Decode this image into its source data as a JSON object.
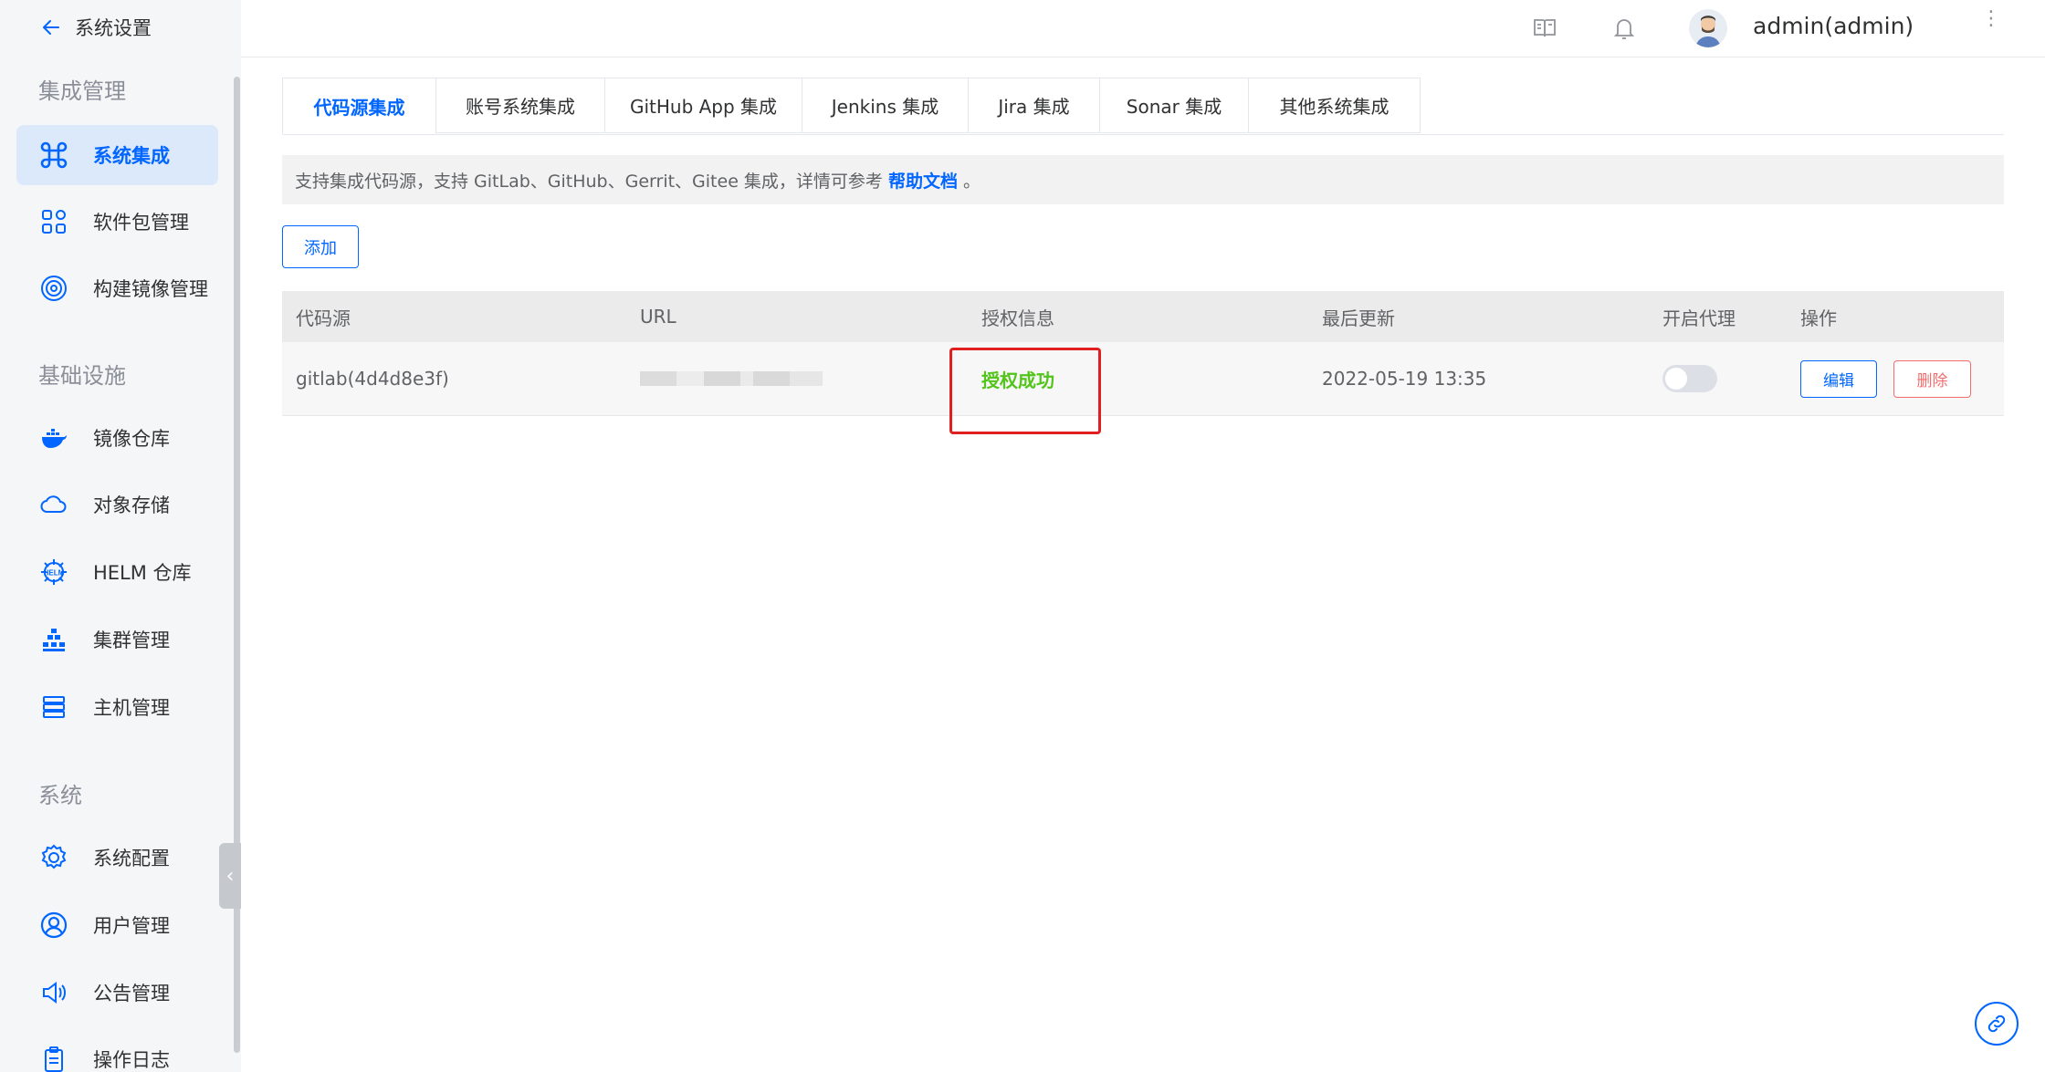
{
  "sidebar": {
    "back_label": "系统设置",
    "sections": [
      {
        "title": "集成管理"
      },
      {
        "title": "基础设施"
      },
      {
        "title": "系统"
      }
    ],
    "items": [
      {
        "label": "系统集成",
        "icon": "command-icon",
        "active": true
      },
      {
        "label": "软件包管理",
        "icon": "apps-grid-icon"
      },
      {
        "label": "构建镜像管理",
        "icon": "target-icon"
      },
      {
        "label": "镜像仓库",
        "icon": "docker-icon"
      },
      {
        "label": "对象存储",
        "icon": "cloud-icon"
      },
      {
        "label": "HELM 仓库",
        "icon": "helm-icon"
      },
      {
        "label": "集群管理",
        "icon": "cluster-icon"
      },
      {
        "label": "主机管理",
        "icon": "server-icon"
      },
      {
        "label": "系统配置",
        "icon": "gear-icon"
      },
      {
        "label": "用户管理",
        "icon": "user-icon"
      },
      {
        "label": "公告管理",
        "icon": "speaker-icon"
      },
      {
        "label": "操作日志",
        "icon": "clipboard-icon"
      }
    ]
  },
  "header": {
    "username": "admin(admin)",
    "icons": [
      "docs-book-icon",
      "bell-icon",
      "avatar",
      "more-vertical-icon"
    ]
  },
  "tabs": [
    {
      "label": "代码源集成",
      "active": true
    },
    {
      "label": "账号系统集成"
    },
    {
      "label": "GitHub App 集成"
    },
    {
      "label": "Jenkins 集成"
    },
    {
      "label": "Jira 集成"
    },
    {
      "label": "Sonar 集成"
    },
    {
      "label": "其他系统集成"
    }
  ],
  "info": {
    "text": "支持集成代码源，支持 GitLab、GitHub、Gerrit、Gitee 集成，详情可参考",
    "link": "帮助文档",
    "tail": "。"
  },
  "add_button": "添加",
  "table": {
    "columns": [
      "代码源",
      "URL",
      "授权信息",
      "最后更新",
      "开启代理",
      "操作"
    ],
    "rows": [
      {
        "source": "gitlab(4d4d8e3f)",
        "url": "",
        "auth": "授权成功",
        "updated": "2022-05-19 13:35",
        "proxy": false,
        "edit": "编辑",
        "delete": "删除"
      }
    ]
  },
  "colors": {
    "primary": "#0066ff",
    "success": "#52c41a",
    "danger": "#f56c6c",
    "highlight": "#e02020"
  }
}
